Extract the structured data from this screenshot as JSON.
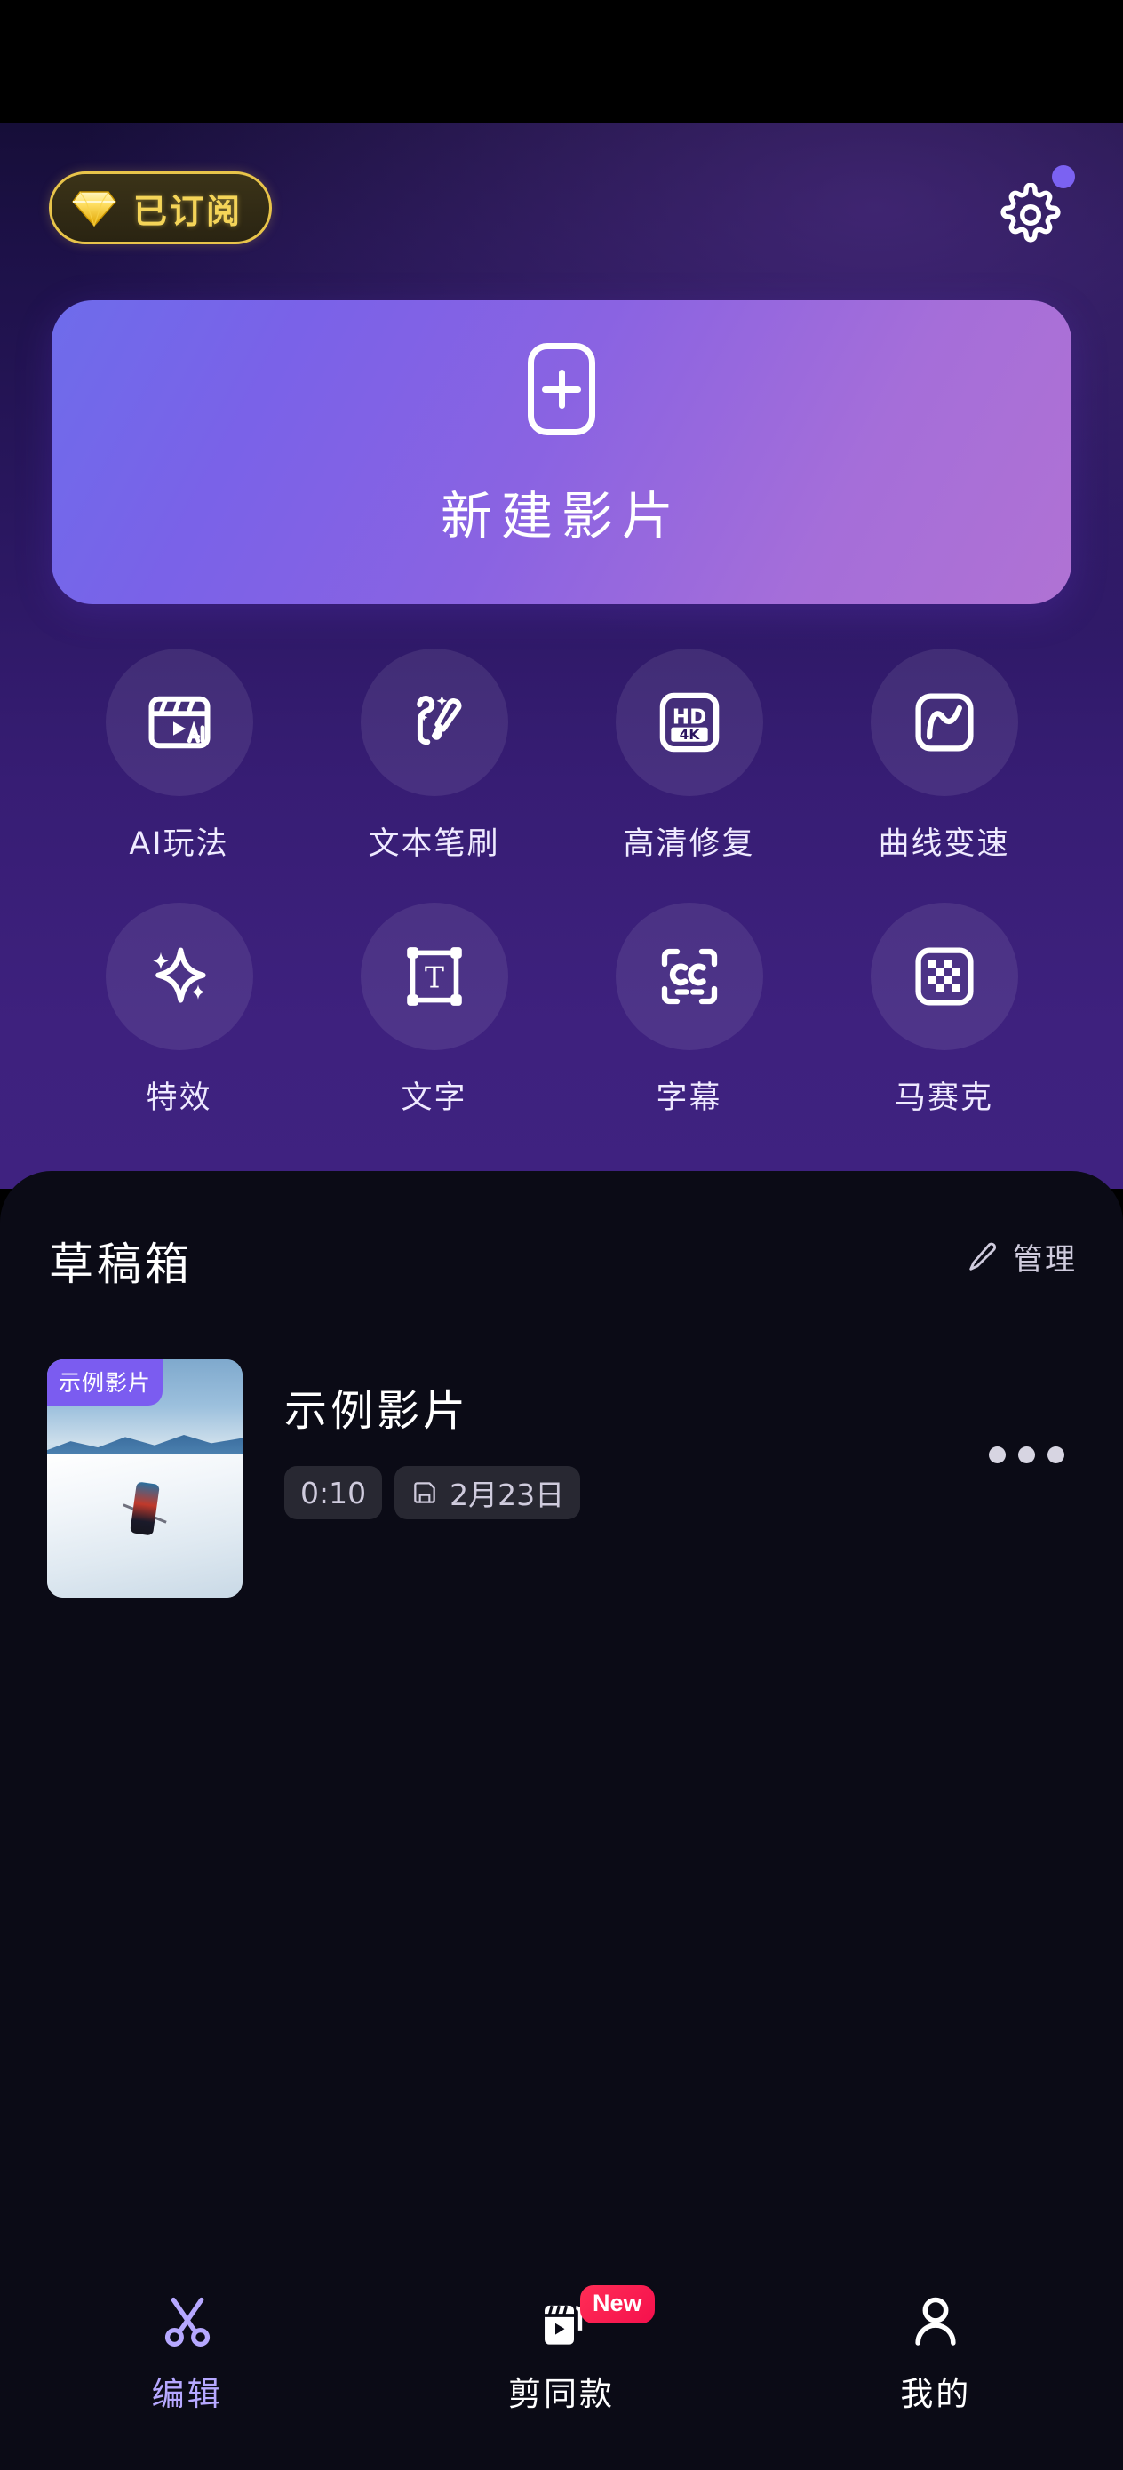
{
  "app": {
    "subscription_badge": {
      "label": "已订阅",
      "icon": "diamond-icon",
      "accent": "#f4d458"
    },
    "settings_icon": "gear-icon",
    "has_notification_dot": true,
    "notification_dot_color": "#7b62f2"
  },
  "new_video_card": {
    "label": "新建影片",
    "icon": "plus-icon",
    "gradient_from": "#6e6ceb",
    "gradient_to": "#b072d4"
  },
  "features": [
    {
      "label": "AI玩法",
      "icon": "ai-clapperboard-icon"
    },
    {
      "label": "文本笔刷",
      "icon": "text-brush-icon"
    },
    {
      "label": "高清修复",
      "icon": "hd-4k-icon"
    },
    {
      "label": "曲线变速",
      "icon": "speed-curve-icon"
    },
    {
      "label": "特效",
      "icon": "sparkle-icon"
    },
    {
      "label": "文字",
      "icon": "text-box-icon"
    },
    {
      "label": "字幕",
      "icon": "closed-caption-icon"
    },
    {
      "label": "马赛克",
      "icon": "mosaic-icon"
    }
  ],
  "drafts": {
    "title": "草稿箱",
    "manage_label": "管理",
    "manage_icon": "pencil-icon",
    "items": [
      {
        "thumb_badge": "示例影片",
        "name": "示例影片",
        "duration": "0:10",
        "date": "2月23日",
        "date_icon": "save-icon",
        "more_icon": "kebab-icon",
        "badge_color": "#7b5cf0"
      }
    ]
  },
  "bottom_nav": {
    "active_index": 0,
    "active_color": "#b6a8ff",
    "items": [
      {
        "label": "编辑",
        "icon": "scissors-icon",
        "badge": ""
      },
      {
        "label": "剪同款",
        "icon": "template-icon",
        "badge": "New"
      },
      {
        "label": "我的",
        "icon": "person-icon",
        "badge": ""
      }
    ]
  }
}
